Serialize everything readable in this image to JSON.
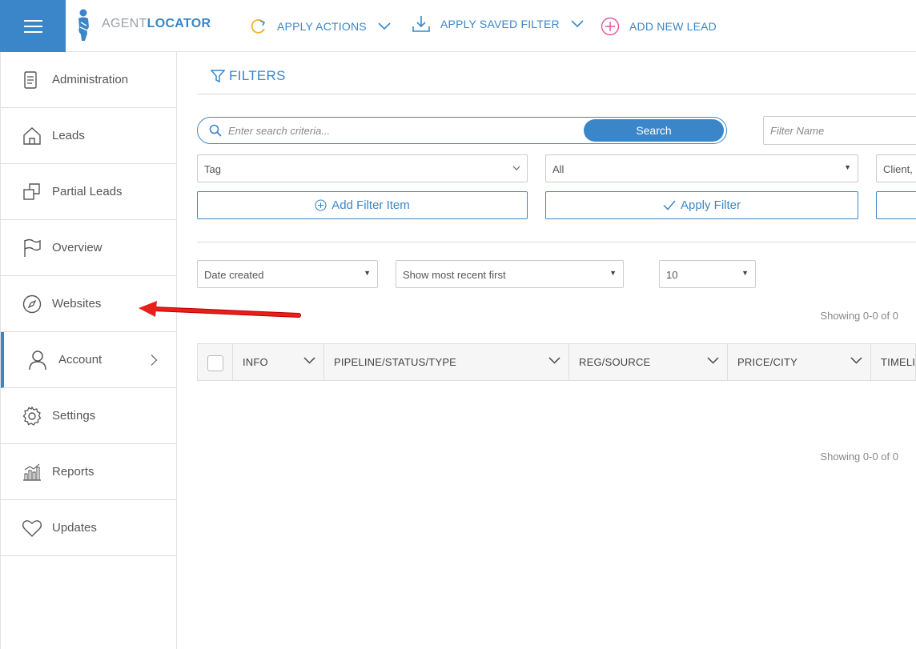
{
  "app": {
    "logo_text_light": "AGENT",
    "logo_text_bold": "LOCATOR",
    "accent_color": "#3a86c8"
  },
  "topbar": {
    "actions": [
      {
        "label": "APPLY ACTIONS",
        "icon": "refresh-icon",
        "has_dropdown": true
      },
      {
        "label": "APPLY SAVED FILTER",
        "icon": "download-icon",
        "has_dropdown": true
      },
      {
        "label": "ADD NEW LEAD",
        "icon": "plus-circle-icon",
        "has_dropdown": false
      }
    ]
  },
  "sidebar": {
    "items": [
      {
        "label": "Administration",
        "icon": "document-icon"
      },
      {
        "label": "Leads",
        "icon": "home-icon"
      },
      {
        "label": "Partial Leads",
        "icon": "copy-icon"
      },
      {
        "label": "Overview",
        "icon": "flag-icon"
      },
      {
        "label": "Websites",
        "icon": "compass-icon"
      },
      {
        "label": "Account",
        "icon": "user-icon",
        "active": true,
        "has_submenu": true
      },
      {
        "label": "Settings",
        "icon": "gear-icon"
      },
      {
        "label": "Reports",
        "icon": "bar-chart-icon"
      },
      {
        "label": "Updates",
        "icon": "heart-icon"
      }
    ]
  },
  "filters": {
    "title": "FILTERS",
    "search_placeholder": "Enter search criteria...",
    "search_button": "Search",
    "filter_name_placeholder": "Filter Name",
    "tag_select": "Tag",
    "all_select": "All",
    "client_select": "Client, L",
    "add_filter_item": "Add Filter Item",
    "apply_filter": "Apply Filter"
  },
  "sorting": {
    "sort_by": "Date created",
    "order": "Show most recent first",
    "per_page": "10"
  },
  "table": {
    "showing_top": "Showing 0-0 of 0",
    "showing_bottom": "Showing 0-0 of 0",
    "columns": [
      "INFO",
      "PIPELINE/STATUS/TYPE",
      "REG/SOURCE",
      "PRICE/CITY",
      "TIMELIN"
    ]
  }
}
